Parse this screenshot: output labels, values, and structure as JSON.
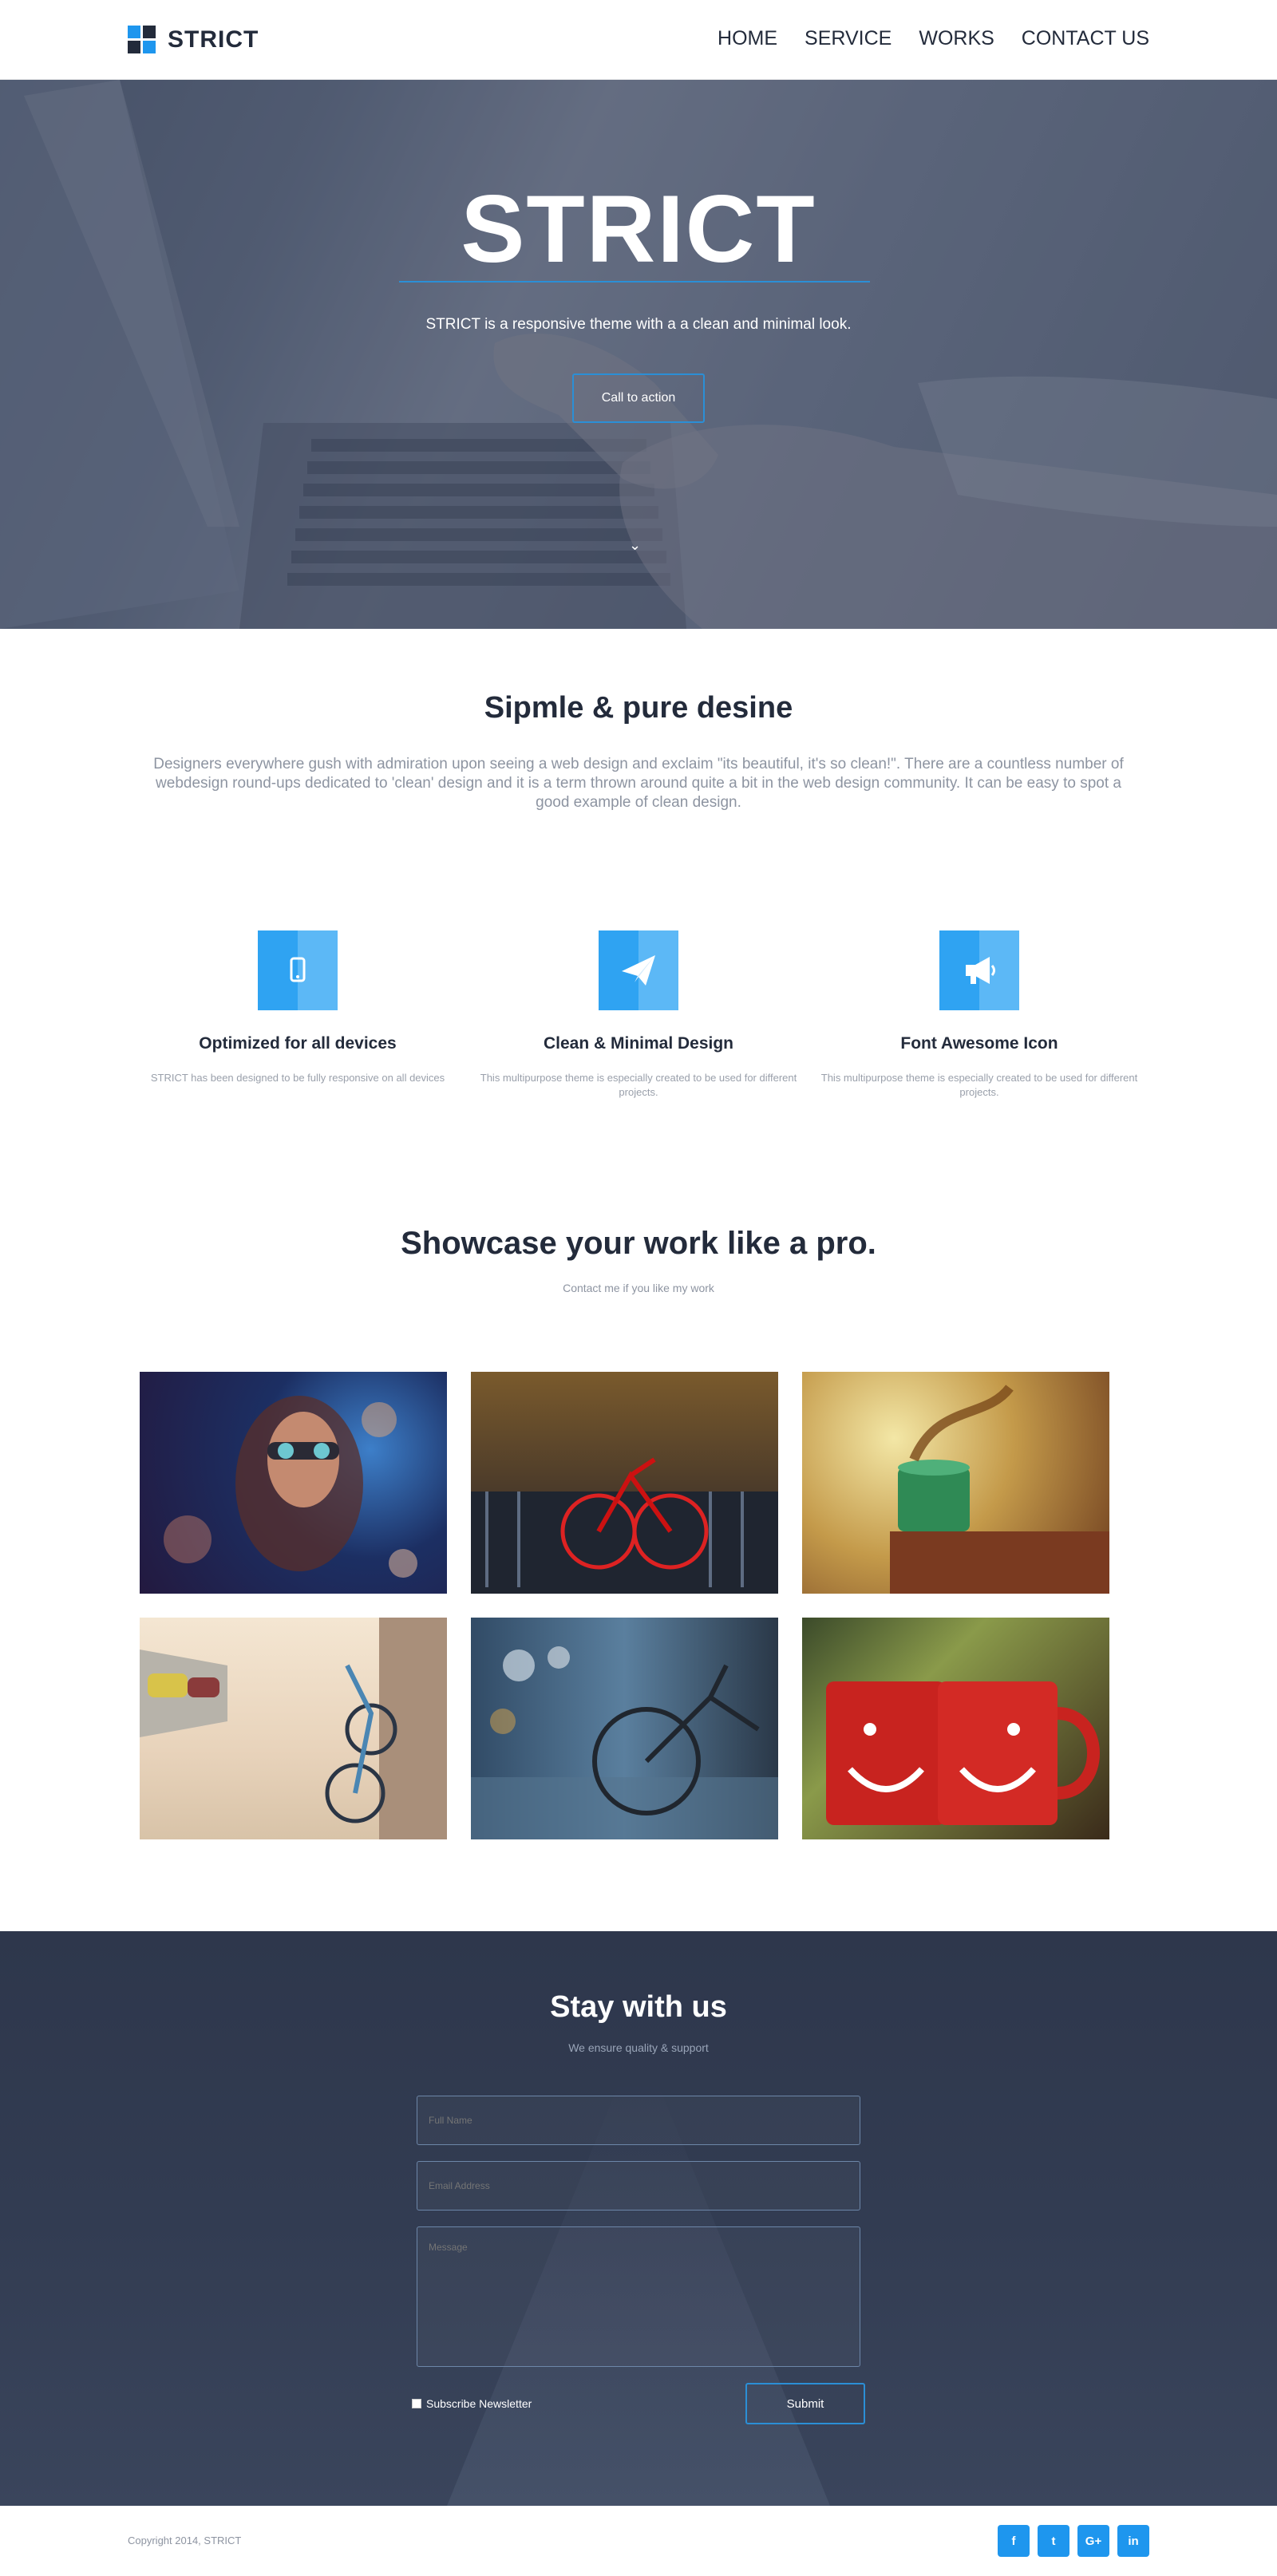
{
  "brand": {
    "name": "STRICT",
    "colors": {
      "accent": "#2b8fd6",
      "icon_blue": "#2fa3f2",
      "dark": "#232b3b"
    }
  },
  "nav": {
    "items": [
      "HOME",
      "SERVICE",
      "WORKS",
      "CONTACT US"
    ]
  },
  "hero": {
    "title": "STRICT",
    "subtitle": "STRICT is a responsive theme with a a clean and minimal look.",
    "cta_label": "Call to action",
    "scroll_icon": "chevron-down-icon"
  },
  "intro": {
    "title": "Sipmle & pure desine",
    "text": "Designers everywhere gush with admiration upon seeing a web design and exclaim \"its beautiful, it's so clean!\". There are a countless number of webdesign round-ups dedicated to 'clean' design and it is a term thrown around quite a bit in the web design community. It can be easy to spot a good example of clean design."
  },
  "features": [
    {
      "icon": "mobile-icon",
      "title": "Optimized for all devices",
      "text": "STRICT has been designed to be fully responsive on all devices"
    },
    {
      "icon": "paper-plane-icon",
      "title": "Clean & Minimal Design",
      "text": "This multipurpose theme is especially created to be used for different projects."
    },
    {
      "icon": "megaphone-icon",
      "title": "Font Awesome Icon",
      "text": "This multipurpose theme is especially created to be used for different projects."
    }
  ],
  "showcase": {
    "title": "Showcase your work like a pro.",
    "subtitle": "Contact me if you like my work"
  },
  "contact": {
    "title": "Stay with us",
    "subtitle": "We ensure quality & support",
    "fullname_placeholder": "Full Name",
    "email_placeholder": "Email Address",
    "message_placeholder": "Message",
    "subscribe_label": "Subscribe Newsletter",
    "submit_label": "Submit"
  },
  "footer": {
    "copyright": "Copyright 2014, STRICT",
    "socials": [
      "f",
      "t",
      "G+",
      "in"
    ]
  }
}
